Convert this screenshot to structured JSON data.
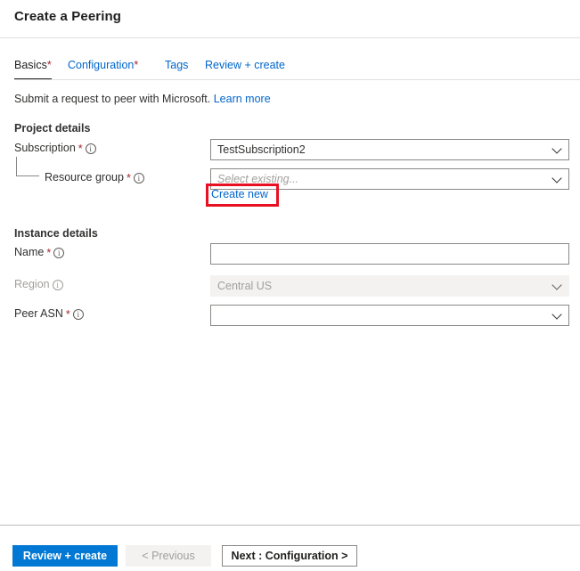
{
  "header": {
    "title": "Create a Peering"
  },
  "tabs": [
    {
      "label": "Basics",
      "required": "*",
      "active": true
    },
    {
      "label": "Configuration",
      "required": "*",
      "active": false
    },
    {
      "label": "Tags",
      "required": "",
      "active": false
    },
    {
      "label": "Review + create",
      "required": "",
      "active": false
    }
  ],
  "subtitle": {
    "text": "Submit a request to peer with Microsoft.",
    "link_label": "Learn more"
  },
  "sections": {
    "project_details": {
      "heading": "Project details",
      "fields": {
        "subscription": {
          "label": "Subscription",
          "required": "*",
          "value": "TestSubscription2",
          "placeholder": "",
          "disabled": false
        },
        "resource_group": {
          "label": "Resource group",
          "required": "*",
          "value": "",
          "placeholder": "Select existing...",
          "disabled": false,
          "create_new_label": "Create new"
        }
      }
    },
    "instance_details": {
      "heading": "Instance details",
      "fields": {
        "name": {
          "label": "Name",
          "required": "*",
          "value": "",
          "placeholder": "",
          "disabled": false
        },
        "region": {
          "label": "Region",
          "required": "",
          "value": "Central US",
          "placeholder": "",
          "disabled": true
        },
        "peer_asn": {
          "label": "Peer ASN",
          "required": "*",
          "value": "",
          "placeholder": "",
          "disabled": false
        }
      }
    }
  },
  "footer": {
    "review_create_label": "Review + create",
    "previous_label": "< Previous",
    "next_label": "Next : Configuration >"
  },
  "annotation": {
    "target": "Create new",
    "color": "#e81123"
  },
  "colors": {
    "accent": "#0078d4",
    "link": "#0066cc",
    "required": "#a4262c",
    "annotation": "#e81123",
    "disabled_bg": "#f3f2f1",
    "disabled_text": "#a19f9d",
    "border": "#8a8886"
  }
}
